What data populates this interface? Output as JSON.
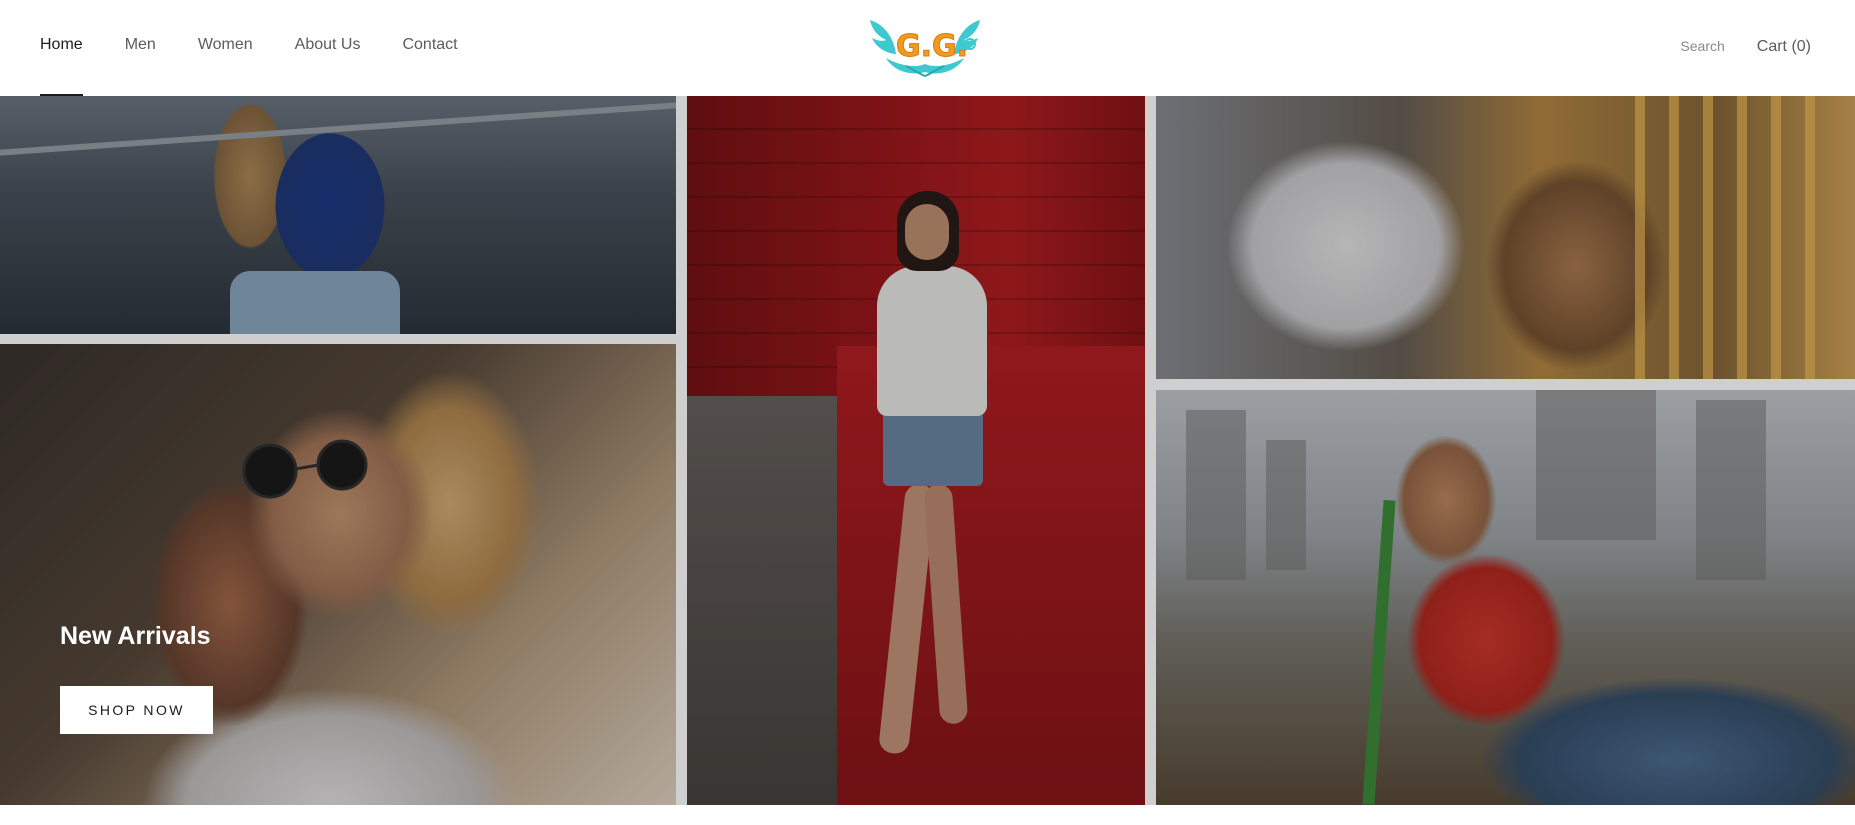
{
  "nav": {
    "items": [
      {
        "label": "Home",
        "active": true
      },
      {
        "label": "Men",
        "active": false
      },
      {
        "label": "Women",
        "active": false
      },
      {
        "label": "About Us",
        "active": false
      },
      {
        "label": "Contact",
        "active": false
      }
    ],
    "search_label": "Search",
    "cart_label": "Cart (0)"
  },
  "logo": {
    "letters": "G.G.",
    "colors": {
      "wings": "#3ec8cf",
      "letters": "#f29a1f"
    }
  },
  "hero": {
    "title": "New Arrivals",
    "button_label": "SHOP NOW"
  },
  "colors": {
    "text": "#1c1b1b",
    "muted": "#5c5c5c",
    "background": "#ffffff"
  }
}
